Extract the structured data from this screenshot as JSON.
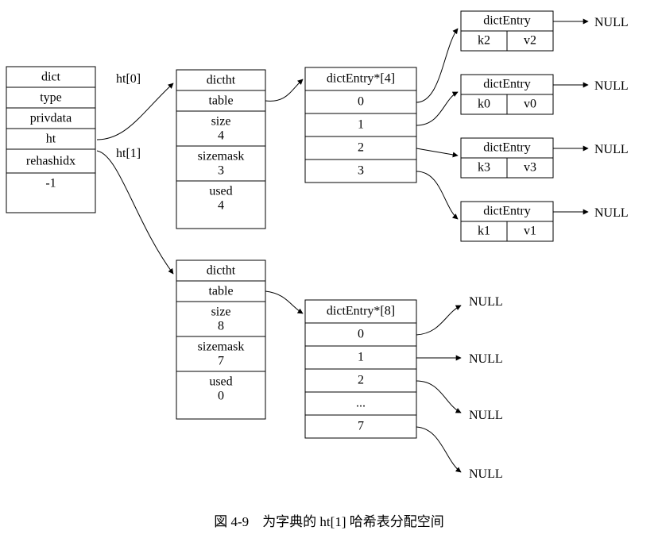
{
  "dict_node": {
    "title": "dict",
    "type_label": "type",
    "privdata_label": "privdata",
    "ht_label": "ht",
    "rehashidx_label": "rehashidx",
    "rehashidx_value": "-1"
  },
  "edge_labels": {
    "ht0": "ht[0]",
    "ht1": "ht[1]"
  },
  "dictht0": {
    "title": "dictht",
    "table_label": "table",
    "size_label": "size",
    "size_value": "4",
    "sizemask_label": "sizemask",
    "sizemask_value": "3",
    "used_label": "used",
    "used_value": "4"
  },
  "dictht1": {
    "title": "dictht",
    "table_label": "table",
    "size_label": "size",
    "size_value": "8",
    "sizemask_label": "sizemask",
    "sizemask_value": "7",
    "used_label": "used",
    "used_value": "0"
  },
  "table0": {
    "header": "dictEntry*[4]",
    "rows": [
      "0",
      "1",
      "2",
      "3"
    ]
  },
  "table1": {
    "header": "dictEntry*[8]",
    "rows": [
      "0",
      "1",
      "2",
      "...",
      "7"
    ]
  },
  "entries": [
    {
      "title": "dictEntry",
      "key": "k2",
      "value": "v2"
    },
    {
      "title": "dictEntry",
      "key": "k0",
      "value": "v0"
    },
    {
      "title": "dictEntry",
      "key": "k3",
      "value": "v3"
    },
    {
      "title": "dictEntry",
      "key": "k1",
      "value": "v1"
    }
  ],
  "null_label": "NULL",
  "caption_prefix": "図 4-9",
  "caption_text": "为字典的 ht[1] 哈希表分配空间"
}
